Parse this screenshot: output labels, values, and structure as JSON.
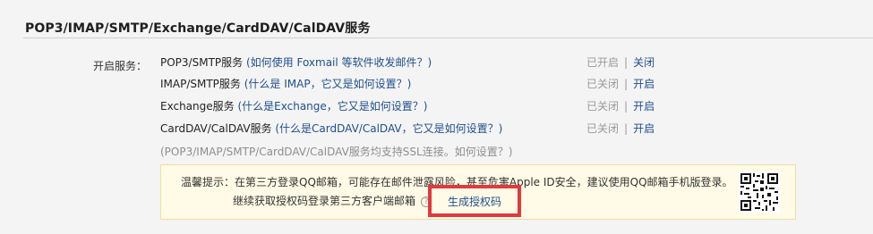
{
  "section": {
    "title": "POP3/IMAP/SMTP/Exchange/CardDAV/CalDAV服务"
  },
  "services": {
    "label": "开启服务：",
    "rows": [
      {
        "name": "POP3/SMTP服务",
        "help": "(如何使用 Foxmail 等软件收发邮件？)",
        "status": "已开启",
        "sep": "|",
        "action": "关闭"
      },
      {
        "name": "IMAP/SMTP服务",
        "help": "(什么是 IMAP，它又是如何设置？)",
        "status": "已关闭",
        "sep": "|",
        "action": "开启"
      },
      {
        "name": "Exchange服务",
        "help": "(什么是Exchange，它又是如何设置？)",
        "status": "已关闭",
        "sep": "|",
        "action": "开启"
      },
      {
        "name": "CardDAV/CalDAV服务",
        "help": "(什么是CardDAV/CalDAV，它又是如何设置？)",
        "status": "已关闭",
        "sep": "|",
        "action": "开启"
      }
    ],
    "ssl_note": "(POP3/IMAP/SMTP/CardDAV/CalDAV服务均支持SSL连接。如何设置？)"
  },
  "tip": {
    "line1": "温馨提示：在第三方登录QQ邮箱，可能存在邮件泄露风险，甚至危害Apple ID安全，建议使用QQ邮箱手机版登录。",
    "line2": "继续获取授权码登录第三方客户端邮箱",
    "help_glyph": "?",
    "generate_button": "生成授权码"
  },
  "icons": {
    "help": "help-circle-icon",
    "qr": "qr-code-icon"
  },
  "colors": {
    "link": "#1f4e8c",
    "highlight": "#e0393e",
    "tip_bg": "#fffbe6"
  }
}
